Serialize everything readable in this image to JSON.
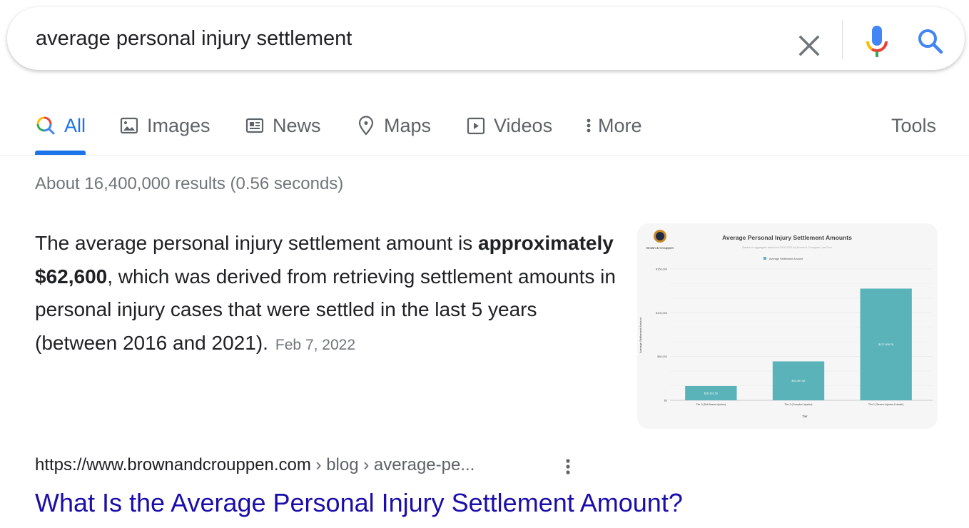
{
  "search": {
    "query": "average personal injury settlement",
    "clear_icon": "close-icon",
    "mic_icon": "microphone-icon",
    "search_icon": "search-icon"
  },
  "tabs": [
    {
      "label": "All",
      "icon": "search-multicolor-icon",
      "active": true
    },
    {
      "label": "Images",
      "icon": "image-icon",
      "active": false
    },
    {
      "label": "News",
      "icon": "newspaper-icon",
      "active": false
    },
    {
      "label": "Maps",
      "icon": "map-pin-icon",
      "active": false
    },
    {
      "label": "Videos",
      "icon": "play-box-icon",
      "active": false
    },
    {
      "label": "More",
      "icon": "vertical-dots-icon",
      "active": false
    }
  ],
  "tools_label": "Tools",
  "result_stats": "About 16,400,000 results (0.56 seconds)",
  "snippet": {
    "text_before": "The average personal injury settlement amount is ",
    "bold": "approximately $62,600",
    "text_after": ", which was derived from retrieving settlement amounts in personal injury cases that were settled in the last 5 years (between 2016 and 2021).",
    "date": "Feb 7, 2022"
  },
  "result": {
    "url_domain": "https://www.brownandcrouppen.com",
    "url_path": " › blog › average-pe...",
    "title": "What Is the Average Personal Injury Settlement Amount?"
  },
  "colors": {
    "accent_blue": "#1a73e8",
    "link_blue": "#1a0dab",
    "bar_teal": "#5bb3ba"
  },
  "chart_data": {
    "type": "bar",
    "title": "Average Personal Injury Settlement Amounts",
    "subtitle": "Based on aggregate data from 2016-2021 by Brown & Crouppen Law Firm",
    "legend": [
      "Average Settlement Amount"
    ],
    "logo_text": "Brown & Crouppen",
    "xlabel": "Tier",
    "ylabel": "Average Settlement Amount",
    "categories": [
      "Tier 3 (Soft tissue injuries)",
      "Tier 2 (Complex injuries)",
      "Tier 1 (Severe injuries & death)"
    ],
    "values": [
      16331.5,
      44457.82,
      127608.78
    ],
    "value_labels": [
      "$16,331.50",
      "$44,457.82",
      "$127,608.78"
    ],
    "yticks": [
      0,
      50000,
      100000,
      150000
    ],
    "ytick_labels": [
      "$0",
      "$50,000",
      "$100,000",
      "$150,000"
    ],
    "ylim": [
      0,
      150000
    ],
    "grid": true
  }
}
